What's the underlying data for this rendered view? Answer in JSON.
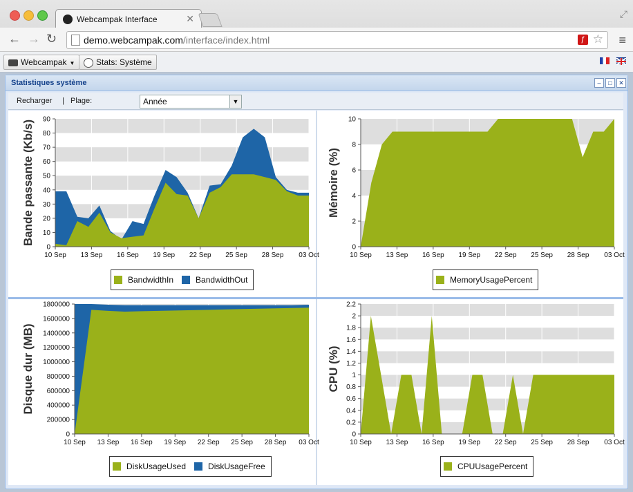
{
  "browser": {
    "tab_title": "Webcampak Interface",
    "url_host": "demo.webcampak.com",
    "url_path": "/interface/index.html"
  },
  "appbar": {
    "menu_label": "Webcampak",
    "stats_label": "Stats: Système"
  },
  "panel": {
    "title": "Statistiques système",
    "reload": "Recharger",
    "separator": "|",
    "range_label": "Plage:",
    "range_value": "Année"
  },
  "colors": {
    "green": "#9ab11a",
    "blue": "#1e65a7",
    "band": "#dedede"
  },
  "x_ticks": [
    "10 Sep",
    "13 Sep",
    "16 Sep",
    "19 Sep",
    "22 Sep",
    "25 Sep",
    "28 Sep",
    "03 Oct"
  ],
  "chart_data": [
    {
      "type": "area",
      "ylabel": "Bande passante (Kb/s)",
      "ylim": [
        0,
        90
      ],
      "yticks": [
        0,
        10,
        20,
        30,
        40,
        50,
        60,
        70,
        80,
        90
      ],
      "series": [
        {
          "name": "BandwidthIn",
          "color": "#9ab11a",
          "values": [
            2,
            1,
            18,
            14,
            24,
            10,
            6,
            7,
            8,
            27,
            45,
            37,
            36,
            20,
            38,
            42,
            51,
            51,
            51,
            49,
            47,
            39,
            36,
            36
          ]
        },
        {
          "name": "BandwidthOut",
          "color": "#1e65a7",
          "values": [
            39,
            39,
            21,
            20,
            29,
            11,
            5,
            18,
            16,
            36,
            54,
            49,
            38,
            20,
            43,
            44,
            57,
            77,
            83,
            77,
            49,
            40,
            38,
            38
          ]
        }
      ]
    },
    {
      "type": "area",
      "ylabel": "Mémoire (%)",
      "ylim": [
        0,
        10
      ],
      "yticks": [
        0,
        2,
        4,
        6,
        8,
        10
      ],
      "series": [
        {
          "name": "MemoryUsagePercent",
          "color": "#9ab11a",
          "values": [
            0,
            5,
            8,
            9,
            9,
            9,
            9,
            9,
            9,
            9,
            9,
            9,
            9,
            10,
            10,
            10,
            10,
            10,
            10,
            10,
            10,
            7,
            9,
            9,
            10
          ]
        }
      ]
    },
    {
      "type": "area",
      "ylabel": "Disque dur (MB)",
      "ylim": [
        0,
        1800000
      ],
      "yticks": [
        0,
        200000,
        400000,
        600000,
        800000,
        1000000,
        1200000,
        1400000,
        1600000,
        1800000
      ],
      "series": [
        {
          "name": "DiskUsageUsed",
          "color": "#9ab11a",
          "values": [
            0,
            1720000,
            1705000,
            1695000,
            1700000,
            1705000,
            1710000,
            1715000,
            1720000,
            1725000,
            1730000,
            1735000,
            1740000,
            1745000,
            1750000
          ]
        },
        {
          "name": "DiskUsageFree",
          "color": "#1e65a7",
          "values": [
            1800000,
            1800000,
            1790000,
            1785000,
            1785000,
            1785000,
            1785000,
            1785000,
            1785000,
            1785000,
            1785000,
            1785000,
            1785000,
            1785000,
            1790000
          ]
        }
      ]
    },
    {
      "type": "area",
      "ylabel": "CPU (%)",
      "ylim": [
        0,
        2.2
      ],
      "yticks": [
        0,
        0.2,
        0.4,
        0.6,
        0.8,
        1,
        1.2,
        1.4,
        1.6,
        1.8,
        2,
        2.2
      ],
      "series": [
        {
          "name": "CPUUsagePercent",
          "color": "#9ab11a",
          "values": [
            0,
            2,
            1,
            0,
            1,
            1,
            0,
            2,
            0,
            0,
            0,
            1,
            1,
            0,
            0,
            1,
            0,
            1,
            1,
            1,
            1,
            1,
            1,
            1,
            1,
            1
          ]
        }
      ]
    }
  ]
}
